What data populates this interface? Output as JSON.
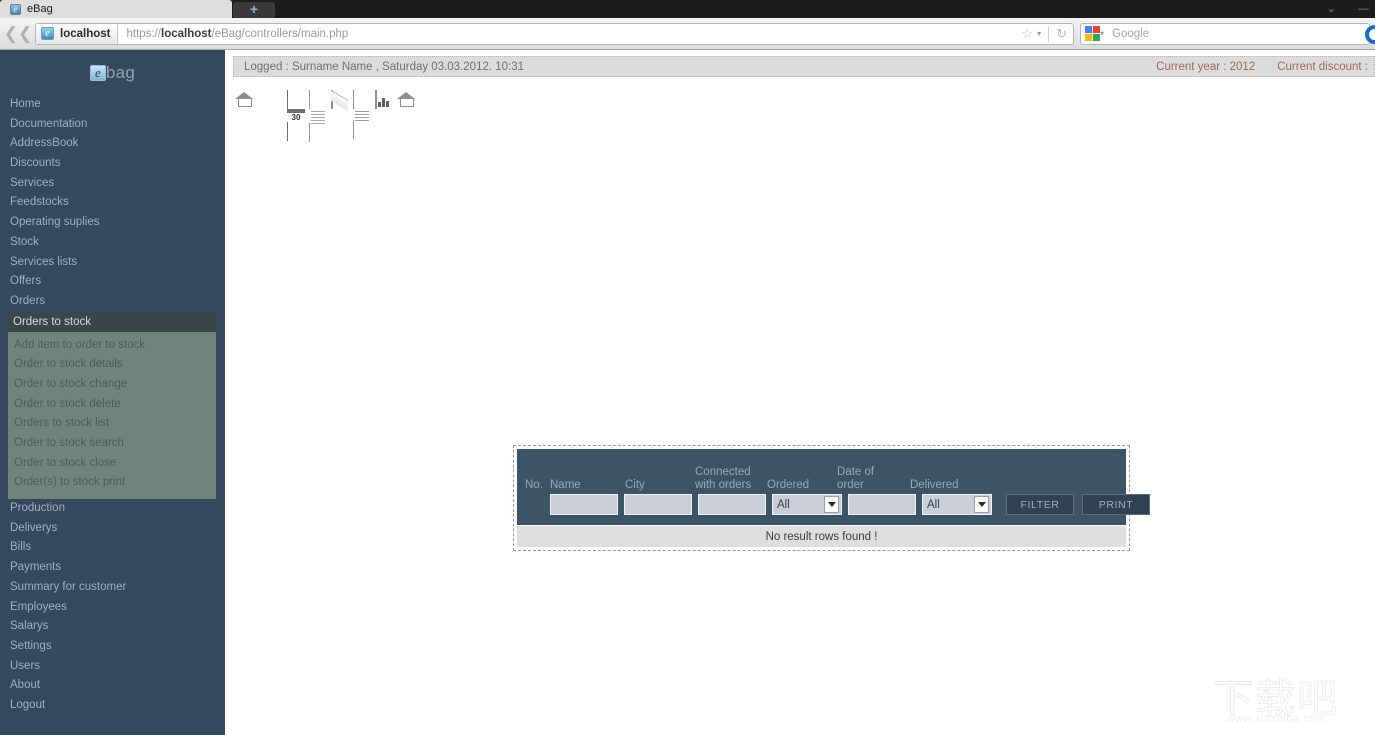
{
  "browser": {
    "tab_title": "eBag",
    "new_tab_label": "+",
    "window_controls": [
      "⌄",
      "—"
    ],
    "back_icon": "back-arrow-icon",
    "identity_label": "localhost",
    "url_prefix": "https://",
    "url_host": "localhost",
    "url_path": "/eBag/controllers/main.php",
    "bookmark_icon": "star-icon",
    "reload_icon": "reload-icon",
    "search_engine": "Google",
    "search_placeholder": "Google",
    "go_icon": "go-circle-icon"
  },
  "sidebar": {
    "brand_mark": "e",
    "brand_text": "bag",
    "items": [
      {
        "label": "Home"
      },
      {
        "label": "Documentation"
      },
      {
        "label": "AddressBook"
      },
      {
        "label": "Discounts"
      },
      {
        "label": "Services"
      },
      {
        "label": "Feedstocks"
      },
      {
        "label": "Operating suplies"
      },
      {
        "label": "Stock"
      },
      {
        "label": "Services lists"
      },
      {
        "label": "Offers"
      },
      {
        "label": "Orders"
      }
    ],
    "selected": {
      "label": "Orders to stock"
    },
    "submenu": [
      {
        "label": "Add item to order to stock"
      },
      {
        "label": "Order to stock details"
      },
      {
        "label": "Order to stock change"
      },
      {
        "label": "Order to stock delete"
      },
      {
        "label": "Orders to stock list"
      },
      {
        "label": "Order to stock search"
      },
      {
        "label": "Order to stock close"
      },
      {
        "label": "Order(s) to stock print"
      }
    ],
    "items_after": [
      {
        "label": "Production"
      },
      {
        "label": "Deliverys"
      },
      {
        "label": "Bills"
      },
      {
        "label": "Payments"
      },
      {
        "label": "Summary for customer"
      },
      {
        "label": "Employees"
      },
      {
        "label": "Salarys"
      },
      {
        "label": "Settings"
      },
      {
        "label": "Users"
      },
      {
        "label": "About"
      },
      {
        "label": "Logout"
      }
    ]
  },
  "statusbar": {
    "logged_text": "Logged :  Surname Name  ,  Saturday 03.03.2012. 10:31",
    "current_year": "Current year :  2012",
    "current_discount": "Current discount :"
  },
  "toolbar": {
    "icons": [
      {
        "name": "home-icon"
      },
      {
        "name": "calendar-icon",
        "day": "30"
      },
      {
        "name": "spreadsheet-icon"
      },
      {
        "name": "mail-icon"
      },
      {
        "name": "document-list-icon"
      },
      {
        "name": "chart-icon"
      },
      {
        "name": "home-back-icon"
      }
    ]
  },
  "filter": {
    "columns": [
      {
        "label": "No."
      },
      {
        "label": "Name"
      },
      {
        "label": "City"
      },
      {
        "label": "Connected\nwith orders"
      },
      {
        "label": "Ordered"
      },
      {
        "label": "Date of\norder"
      },
      {
        "label": "Delivered"
      }
    ],
    "col_no": "No.",
    "col_name": "Name",
    "col_city": "City",
    "col_connected_1": "Connected",
    "col_connected_2": "with orders",
    "col_ordered": "Ordered",
    "col_date_1": "Date of",
    "col_date_2": "order",
    "col_delivered": "Delivered",
    "name_value": "",
    "city_value": "",
    "connected_value": "",
    "ordered_value": "All",
    "date_value": "",
    "delivered_value": "All",
    "filter_button": "FILTER",
    "print_button": "PRINT",
    "result_message": "No result rows found !"
  },
  "watermark": {
    "cn_text": "下载吧",
    "url_text": "www.xiazaiba.com"
  },
  "colors": {
    "sidebar_bg": "#34495e",
    "submenu_bg": "#6f857c",
    "panel_bg": "#3d5366",
    "accent_meta": "#9a6a55",
    "button_bg": "#2f4153"
  }
}
